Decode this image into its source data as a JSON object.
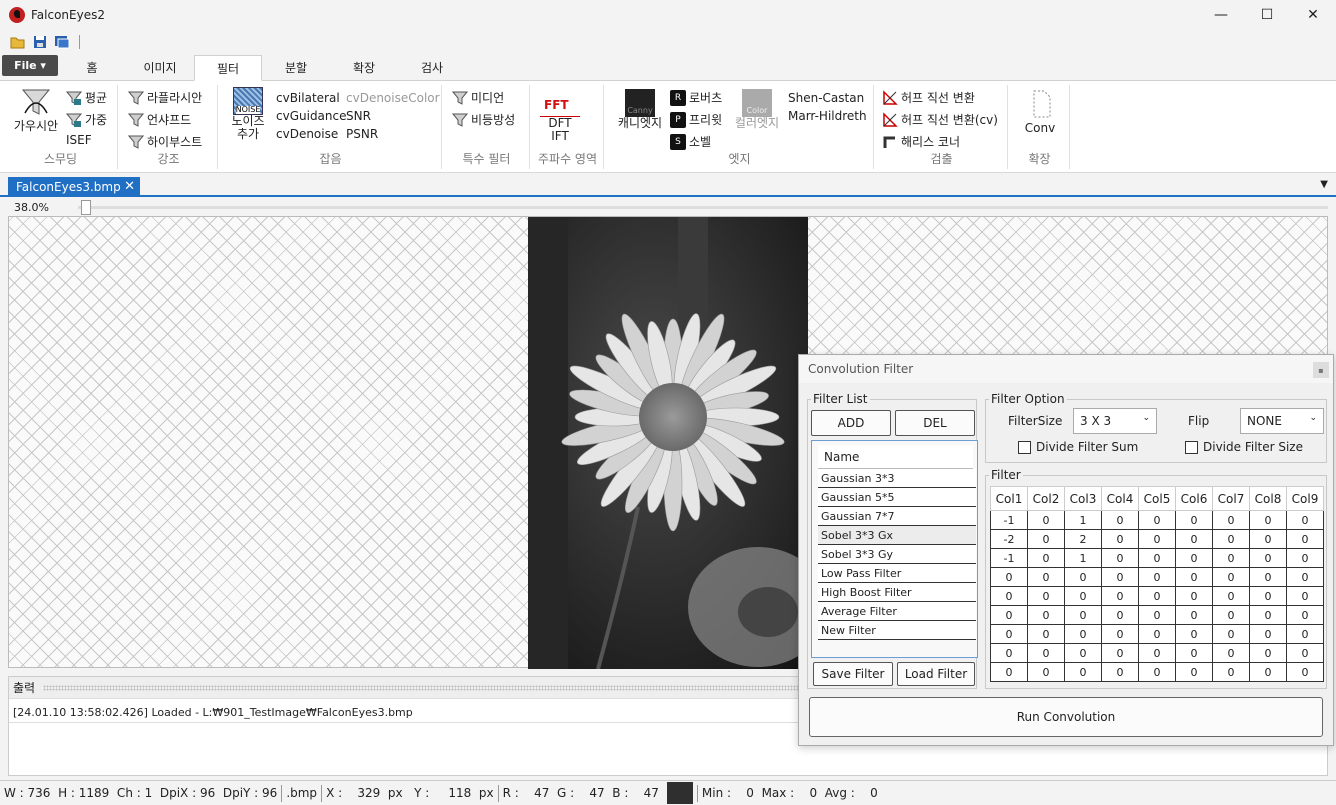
{
  "window": {
    "title": "FalconEyes2",
    "minimize": "—",
    "maximize": "☐",
    "close": "✕"
  },
  "ribbon_tabs": {
    "file": "File ▾",
    "tabs": [
      "홈",
      "이미지",
      "필터",
      "분할",
      "확장",
      "검사"
    ],
    "active": "필터"
  },
  "ribbon": {
    "smoothing": {
      "label": "스무딩",
      "gaussian": "가우시안",
      "average": "평균",
      "weighted": "가중",
      "isef": "ISEF"
    },
    "enhance": {
      "label": "강조",
      "laplacian": "라플라시안",
      "unsharp": "언샤프드",
      "highboost": "하이부스트"
    },
    "noise": {
      "label": "잡음",
      "add_noise": "노이즈 추가",
      "noise_icon": "NOISE",
      "cv_bilateral": "cvBilateral",
      "cv_guidance": "cvGuidance",
      "cv_denoise": "cvDenoise",
      "cv_denoise_color": "cvDenoiseColor",
      "snr": "SNR",
      "psnr": "PSNR"
    },
    "special": {
      "label": "특수 필터",
      "median": "미디언",
      "anisotropic": "비등방성"
    },
    "frequency": {
      "label": "주파수 영역",
      "fft_icon": "FFT",
      "dft": "DFT",
      "ift": "IFT"
    },
    "edge": {
      "label": "엣지",
      "canny": "캐니엣지",
      "canny_icon": "Canny",
      "roberts": "로버츠",
      "prewitt": "프리윗",
      "sobel": "소벨",
      "color_edge": "컬러엣지",
      "color_icon": "Color",
      "shen_castan": "Shen-Castan",
      "marr_hildreth": "Marr-Hildreth"
    },
    "detect": {
      "label": "검출",
      "hough_line": "허프 직선 변환",
      "hough_line_cv": "허프 직선 변환(cv)",
      "harris": "해리스 코너"
    },
    "extend": {
      "label": "확장",
      "conv": "Conv"
    }
  },
  "document": {
    "tab_name": "FalconEyes3.bmp",
    "zoom": "38.0%"
  },
  "output": {
    "title": "출력",
    "log": "[24.01.10 13:58:02.426] Loaded - L:₩901_TestImage₩FalconEyes3.bmp"
  },
  "status": {
    "size": "W : 736  H : 1189  Ch : 1  DpiX : 96  DpiY : 96",
    "ext": ".bmp",
    "pos": "X :    329  px   Y :     118  px",
    "rgb": "R :    47  G :    47  B :    47",
    "stats": "Min :    0  Max :    0  Avg :    0",
    "swatch_color": "#2f2f2f"
  },
  "dialog": {
    "title": "Convolution Filter",
    "filter_list_label": "Filter List",
    "add": "ADD",
    "del": "DEL",
    "list_header": "Name",
    "filters": [
      "Gaussian 3*3",
      "Gaussian 5*5",
      "Gaussian 7*7",
      "Sobel 3*3 Gx",
      "Sobel 3*3 Gy",
      "Low Pass Filter",
      "High Boost Filter",
      "Average Filter",
      "New Filter"
    ],
    "selected_filter": "Sobel 3*3 Gx",
    "save_filter": "Save Filter",
    "load_filter": "Load Filter",
    "option_label": "Filter Option",
    "filter_size_label": "FilterSize",
    "filter_size_value": "3 X 3",
    "flip_label": "Flip",
    "flip_value": "NONE",
    "divide_sum": "Divide Filter Sum",
    "divide_size": "Divide Filter Size",
    "filter_label": "Filter",
    "columns": [
      "Col1",
      "Col2",
      "Col3",
      "Col4",
      "Col5",
      "Col6",
      "Col7",
      "Col8",
      "Col9"
    ],
    "kernel": [
      [
        "-1",
        "0",
        "1",
        "0",
        "0",
        "0",
        "0",
        "0",
        "0"
      ],
      [
        "-2",
        "0",
        "2",
        "0",
        "0",
        "0",
        "0",
        "0",
        "0"
      ],
      [
        "-1",
        "0",
        "1",
        "0",
        "0",
        "0",
        "0",
        "0",
        "0"
      ],
      [
        "0",
        "0",
        "0",
        "0",
        "0",
        "0",
        "0",
        "0",
        "0"
      ],
      [
        "0",
        "0",
        "0",
        "0",
        "0",
        "0",
        "0",
        "0",
        "0"
      ],
      [
        "0",
        "0",
        "0",
        "0",
        "0",
        "0",
        "0",
        "0",
        "0"
      ],
      [
        "0",
        "0",
        "0",
        "0",
        "0",
        "0",
        "0",
        "0",
        "0"
      ],
      [
        "0",
        "0",
        "0",
        "0",
        "0",
        "0",
        "0",
        "0",
        "0"
      ],
      [
        "0",
        "0",
        "0",
        "0",
        "0",
        "0",
        "0",
        "0",
        "0"
      ]
    ],
    "run": "Run Convolution"
  },
  "colors": {
    "accent": "#1f6fc5",
    "file_tab": "#4a4a4a"
  }
}
